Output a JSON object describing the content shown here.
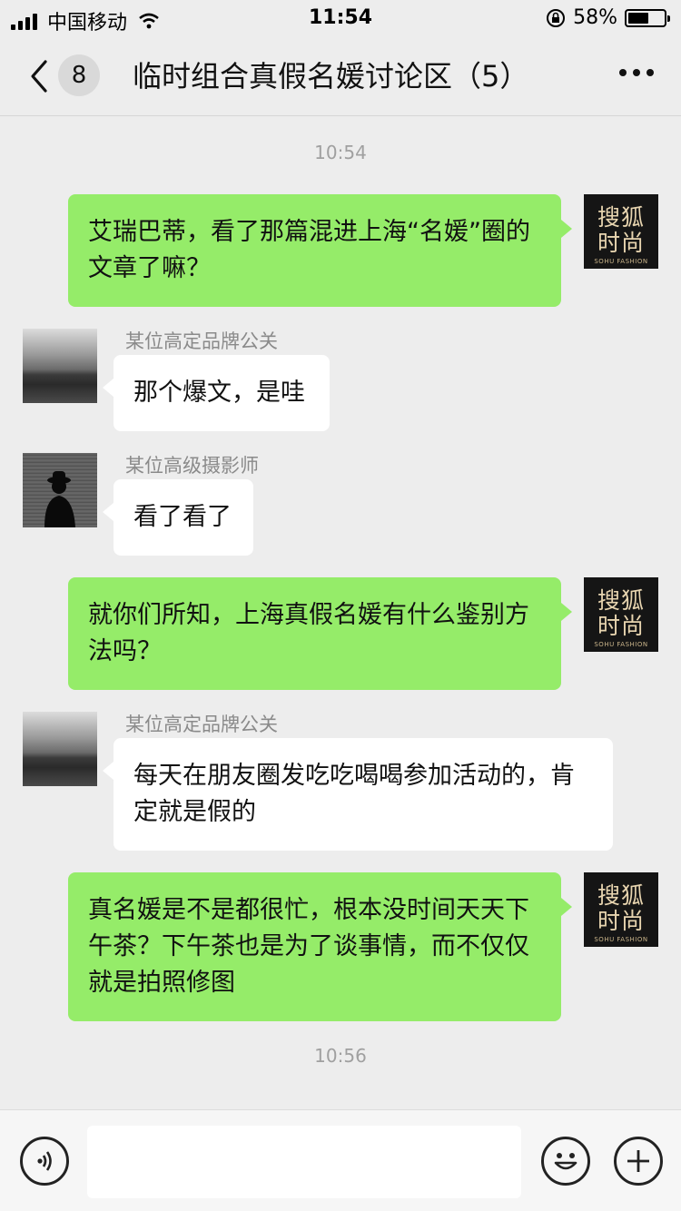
{
  "status_bar": {
    "carrier": "中国移动",
    "time": "11:54",
    "battery_percent": "58%",
    "battery_level": 0.58
  },
  "nav": {
    "unread_count": "8",
    "title": "临时组合真假名媛讨论区（5）"
  },
  "icons": {
    "back": "chevron-left-icon",
    "more": "more-dots-icon",
    "voice": "voice-icon",
    "emoji": "emoji-icon",
    "plus": "plus-icon"
  },
  "colors": {
    "outgoing_bubble": "#95ec69",
    "incoming_bubble": "#ffffff",
    "background": "#ededed"
  },
  "chat": {
    "timestamps": [
      "10:54",
      "10:56"
    ],
    "self_avatar": {
      "logo_line1": "搜狐",
      "logo_line2": "时尚",
      "logo_sub": "SOHU FASHION"
    },
    "messages": [
      {
        "side": "right",
        "text": "艾瑞巴蒂，看了那篇混进上海“名媛”圈的文章了嘛？"
      },
      {
        "side": "left",
        "sender": "某位高定品牌公关",
        "text": "那个爆文，是哇"
      },
      {
        "side": "left",
        "sender": "某位高级摄影师",
        "text": "看了看了"
      },
      {
        "side": "right",
        "text": "就你们所知，上海真假名媛有什么鉴别方法吗？"
      },
      {
        "side": "left",
        "sender": "某位高定品牌公关",
        "text": "每天在朋友圈发吃吃喝喝参加活动的，肯定就是假的"
      },
      {
        "side": "right",
        "text": "真名媛是不是都很忙，根本没时间天天下午茶？下午茶也是为了谈事情，而不仅仅就是拍照修图"
      }
    ]
  }
}
